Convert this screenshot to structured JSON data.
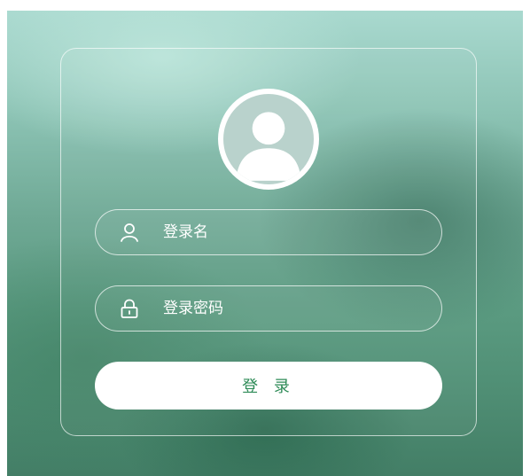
{
  "login_form": {
    "username_placeholder": "登录名",
    "password_placeholder": "登录密码",
    "submit_label": "登 录"
  },
  "icons": {
    "avatar": "user-avatar-icon",
    "username": "user-icon",
    "password": "lock-icon"
  },
  "colors": {
    "accent": "#2e8b57",
    "card_border": "#ffffff",
    "avatar_bg": "#b9d2cc"
  }
}
